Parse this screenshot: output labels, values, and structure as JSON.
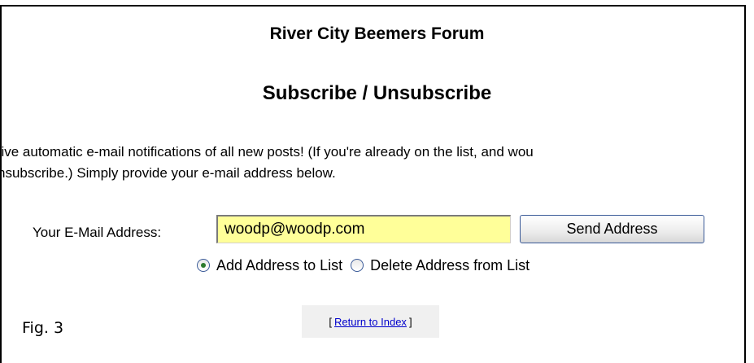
{
  "header": {
    "forum_title": "River City Beemers Forum",
    "page_title": "Subscribe / Unsubscribe"
  },
  "instructions": {
    "line1": "eive automatic e-mail notifications of all new posts! (If you're already on the list, and wou",
    "line2": "nsubscribe.) Simply provide your e-mail address below."
  },
  "form": {
    "email_label": "Your E-Mail Address:",
    "email_value": "woodp@woodp.com",
    "send_button_label": "Send Address",
    "options": [
      {
        "label": "Add Address to List",
        "selected": true
      },
      {
        "label": "Delete Address from List",
        "selected": false
      }
    ]
  },
  "nav": {
    "bracket_open": "[",
    "return_link_label": "Return to Index",
    "bracket_close": "]"
  },
  "caption": "Fig. 3",
  "colors": {
    "input_background": "#ffff99",
    "link": "#0000cc",
    "radio_selected_dot": "#2b7a2b"
  }
}
